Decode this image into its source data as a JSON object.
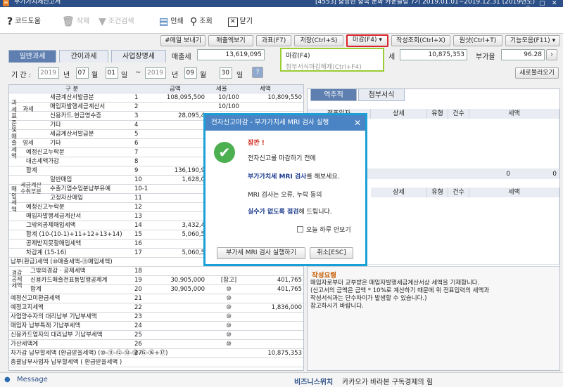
{
  "window": {
    "app_icon": "H",
    "title": "부가가치세신고서",
    "info": "[4553] 중앙현 중국 문화 카운슬링 7기 2019.01.01~2019.12.31 (2019년도)",
    "minimize": "_",
    "restore": "▢",
    "close": "✕"
  },
  "toolbar": {
    "help": "코드도움",
    "delete": "삭제",
    "filter": "조건검색",
    "print": "인쇄",
    "search": "조회",
    "close": "닫기"
  },
  "actions": {
    "email": "#메일 보내기",
    "excel": "매출엑보기",
    "f7": "과표(F7)",
    "save": "저장(Ctrl+S)",
    "deadline": "마감(F4)",
    "write_query": "작성조회(Ctrl+X)",
    "reload": "원샷(Ctrl+T)",
    "function_menu": "기능모음(F11)"
  },
  "tabs": [
    "일반과세",
    "간이과세",
    "사업장명세"
  ],
  "summary": {
    "sales_tax_label": "매출세",
    "sales_tax_value": "13,619,095",
    "payable_label": "세",
    "payable_value": "10,875,353",
    "vat_rate_label": "부가율",
    "vat_rate_value": "96.28"
  },
  "period": {
    "label": "기 간 :",
    "from_year": "2019",
    "year_word": "년",
    "from_month": "07",
    "month_word": "월",
    "from_day": "01",
    "day_word": "일",
    "tilde": "~",
    "to_year": "2019",
    "to_month": "09",
    "to_day": "30",
    "refresh_button": "새로불러오기"
  },
  "deadline_menu": {
    "item1": "마감(F4)",
    "item2": "첨부서식마감해제(Ctrl+F4)"
  },
  "table": {
    "headers": [
      "구 분",
      "금액",
      "세율",
      "세액"
    ],
    "rows": [
      {
        "label": "세금계산서발급분",
        "no": "1",
        "amount": "108,095,500",
        "rate": "10/100",
        "tax": "10,809,550"
      },
      {
        "label": "매입자발행세금계산서",
        "no": "2",
        "amount": "",
        "rate": "10/100",
        "tax": ""
      },
      {
        "label": "신용카드.현금영수증",
        "no": "3",
        "amount": "28,095,4",
        "rate": "",
        "tax": ""
      },
      {
        "label": "기타",
        "no": "4",
        "amount": "",
        "rate": "",
        "tax": ""
      },
      {
        "label": "세금계산서발급분",
        "no": "5",
        "amount": "",
        "rate": "",
        "tax": ""
      },
      {
        "label": "기타",
        "no": "6",
        "amount": "",
        "rate": "",
        "tax": ""
      },
      {
        "label": "예정신고누락분",
        "no": "7",
        "amount": "",
        "rate": "",
        "tax": ""
      },
      {
        "label": "대손세액가감",
        "no": "8",
        "amount": "",
        "rate": "",
        "tax": ""
      },
      {
        "label": "합계",
        "no": "9",
        "amount": "136,190,9",
        "rate": "",
        "tax": ""
      },
      {
        "label": "일반매입",
        "no": "10",
        "amount": "1,628,0",
        "rate": "",
        "tax": ""
      },
      {
        "label": "수출기업수입분납부유예",
        "no": "10-1",
        "amount": "",
        "rate": "",
        "tax": ""
      },
      {
        "label": "고정자산매입",
        "no": "11",
        "amount": "",
        "rate": "",
        "tax": ""
      },
      {
        "label": "예정신고누락분",
        "no": "12",
        "amount": "",
        "rate": "",
        "tax": ""
      },
      {
        "label": "매입자발행세금계산서",
        "no": "13",
        "amount": "",
        "rate": "",
        "tax": ""
      },
      {
        "label": "그밖의공제매입세액",
        "no": "14",
        "amount": "3,432,4",
        "rate": "",
        "tax": ""
      },
      {
        "label": "합계 (10-(10-1)+11+12+13+14)",
        "no": "15",
        "amount": "5,060,5",
        "rate": "",
        "tax": ""
      },
      {
        "label": "공제받지못할매입세액",
        "no": "16",
        "amount": "",
        "rate": "",
        "tax": ""
      },
      {
        "label": "차감계 (15-16)",
        "no": "17",
        "amount": "5,060,5",
        "rate": "",
        "tax": ""
      },
      {
        "label": "납부(환급)세액 (⑩매출세액-⑪매입세액)",
        "no": "",
        "amount": "",
        "rate": "",
        "tax": ""
      },
      {
        "label": "그밖의경감 · 공제세액",
        "no": "18",
        "amount": "",
        "rate": "",
        "tax": ""
      },
      {
        "label": "신용카드매출전표등발행공제계",
        "no": "19",
        "amount": "30,905,000",
        "rate": "[참고]",
        "tax": "401,765"
      },
      {
        "label": "합계",
        "no": "20",
        "amount": "30,905,000",
        "rate": "⑩",
        "tax": "401,765"
      },
      {
        "label": "예정신고미환급세액",
        "no": "21",
        "amount": "",
        "rate": "⑩",
        "tax": ""
      },
      {
        "label": "예정고지세액",
        "no": "22",
        "amount": "",
        "rate": "⑩",
        "tax": "1,836,000"
      },
      {
        "label": "사업양수자의 대리납부 기납부세액",
        "no": "23",
        "amount": "",
        "rate": "⑩",
        "tax": ""
      },
      {
        "label": "매입자 납부특례 기납부세액",
        "no": "24",
        "amount": "",
        "rate": "⑩",
        "tax": ""
      },
      {
        "label": "신용카드업자의 대리납부 기납부세액",
        "no": "25",
        "amount": "",
        "rate": "⑩",
        "tax": ""
      },
      {
        "label": "가산세액계",
        "no": "26",
        "amount": "",
        "rate": "⑩",
        "tax": ""
      },
      {
        "label": "차가감 납부할세액 (환급받을세액) (⑩-⑪-⑫-⑬-⑭-⑮-⑯+⑰)",
        "no": "27",
        "amount": "",
        "rate": "",
        "tax": "10,875,353"
      },
      {
        "label": "총괄납부사업자 납부할세액 ( 환급받을세액 )",
        "no": "",
        "amount": "",
        "rate": "",
        "tax": ""
      }
    ],
    "groups": {
      "tax_base": "과세표준및매출세액",
      "taxable": "과세",
      "zero_rate": "영세",
      "purchase": "매입세액",
      "tax_invoice": "세금계산수취부분",
      "reduce": "경감공제세액"
    }
  },
  "right_panel": {
    "tabs": [
      "역추적",
      "첨부서식"
    ],
    "grid1_headers": [
      "전표일자",
      "상세",
      "유형",
      "건수",
      "세액"
    ],
    "grid1_totals": [
      "0",
      "0"
    ],
    "grid2_headers": [
      "상세",
      "유형",
      "건수",
      "세액"
    ],
    "notes_title": "작성요령",
    "notes": [
      "매입자로부터 교부받은 매입자발행세금계산서상 세액을 기재합니다.",
      "(신고서의 금액은 금액 * 10%로 계산하기 때문에 위 전표입력의 세액과",
      "작성서식과는 단수차이가 발생할 수 있습니다.)",
      "참고하시기 바랍니다."
    ]
  },
  "dialog": {
    "title": "전자신고마감 - 부가가치세 MRI 검사 실행",
    "close": "✕",
    "warning": "잠깐 !",
    "line1": "전자신고를 마감하기 전에",
    "line2_bold": "부가가치세 MRI 검사",
    "line2_rest": "를 해보세요.",
    "line3": "MRI 검사는 오류, 누락 등의",
    "line4_bold": "실수가 없도록 점검",
    "line4_rest": "해 드립니다.",
    "checkbox": "오늘 하루 안보기",
    "run_button": "부가세 MRI 검사 실행하기",
    "cancel_button": "취소[ESC]"
  },
  "status": {
    "message": "Message",
    "biz_label": "비즈니스위치",
    "biz_text": "카카오가 바라본 구독경제의 힘"
  },
  "colors": {
    "accent": "#4a84c4",
    "highlight": "#d9262c",
    "dropdown_border": "#9acd32",
    "dialog_border": "#1aa0d6"
  }
}
